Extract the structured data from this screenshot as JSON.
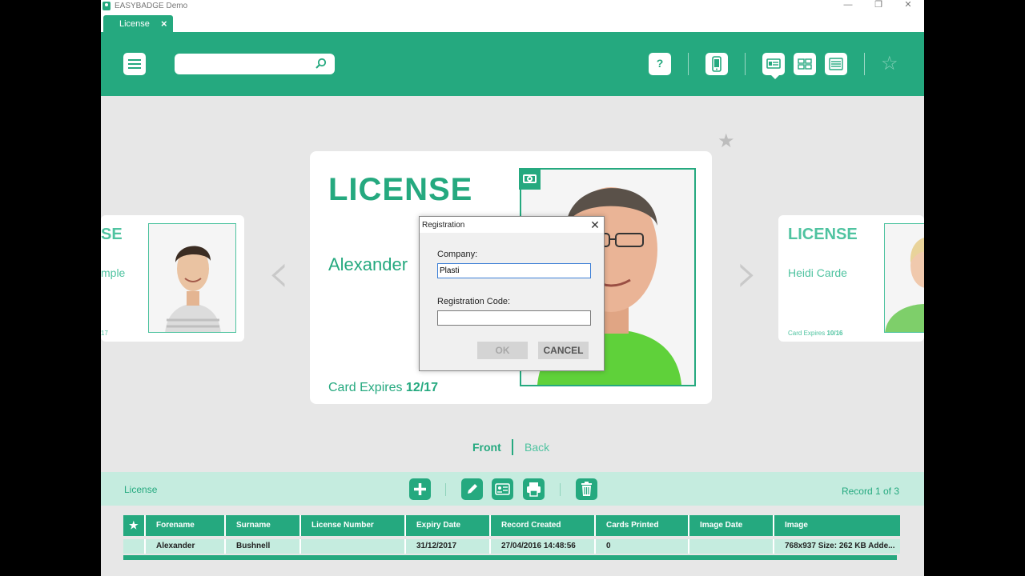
{
  "window": {
    "title": "EASYBADGE Demo",
    "minimize": "—",
    "restore": "❐",
    "close": "✕"
  },
  "tabs": [
    {
      "label": "License",
      "close": "×"
    }
  ],
  "header": {
    "search_value": "",
    "help_label": "?",
    "favorite_icon": "star-icon"
  },
  "card_main": {
    "title": "LICENSE",
    "name": "Alexander",
    "expires_label": "Card Expires ",
    "expires_value": "12/17"
  },
  "card_left": {
    "title": "SE",
    "name": "mple",
    "expires": "17"
  },
  "card_right": {
    "title": "LICENSE",
    "name": "Heidi Carde",
    "expires_label": "Card Expires ",
    "expires_value": "10/16"
  },
  "view_toggle": {
    "front": "Front",
    "back": "Back",
    "active": "front"
  },
  "bottom_bar": {
    "label": "License",
    "record": "Record 1 of 3"
  },
  "table": {
    "columns": [
      "★",
      "Forename",
      "Surname",
      "License Number",
      "Expiry Date",
      "Record Created",
      "Cards Printed",
      "Image Date",
      "Image"
    ],
    "rows": [
      [
        "",
        "Alexander",
        "Bushnell",
        "",
        "31/12/2017",
        "27/04/2016 14:48:56",
        "0",
        "",
        "768x937 Size: 262 KB Adde..."
      ]
    ]
  },
  "dialog": {
    "title": "Registration",
    "close": "✕",
    "company_label": "Company:",
    "company_value": "Plasti",
    "code_label": "Registration Code:",
    "code_value": "",
    "ok": "OK",
    "cancel": "CANCEL"
  },
  "colors": {
    "accent": "#25a97f",
    "accent_light": "#c5ecdf",
    "shirt": "#5fd13a"
  }
}
